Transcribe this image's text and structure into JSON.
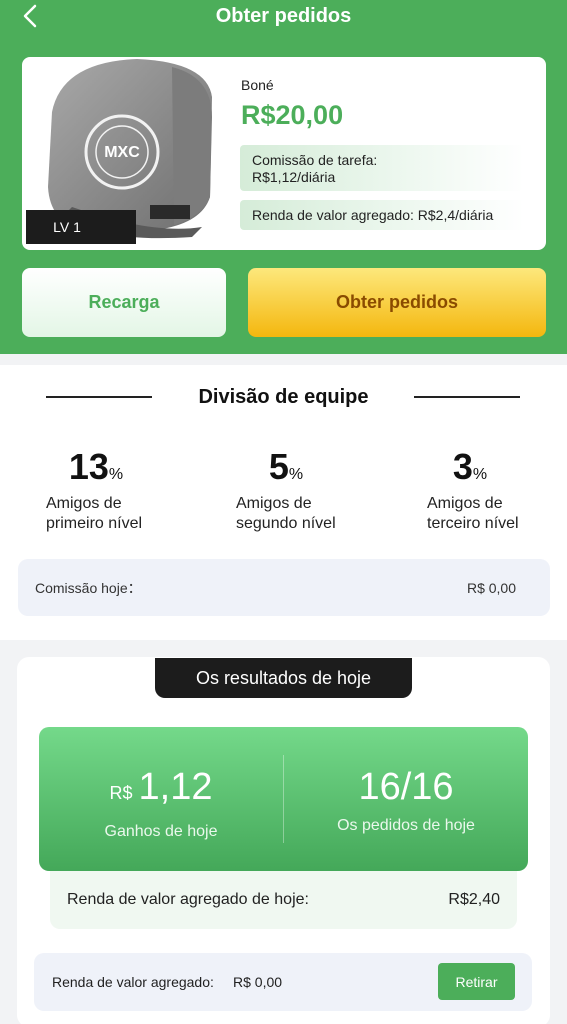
{
  "header": {
    "title": "Obter pedidos"
  },
  "product": {
    "name": "Boné",
    "price": "R$20,00",
    "commission_line1": "Comissão de tarefa:",
    "commission_line2": "R$1,12/diária",
    "value_income": "Renda de valor agregado: R$2,4/diária",
    "level": "LV 1",
    "image_icon": "cap-image"
  },
  "buttons": {
    "recharge": "Recarga",
    "get_orders": "Obter pedidos"
  },
  "team": {
    "title": "Divisão de equipe",
    "levels": [
      {
        "value": "13",
        "unit": "%",
        "label_line1": "Amigos de",
        "label_line2": "primeiro nível"
      },
      {
        "value": "5",
        "unit": "%",
        "label_line1": "Amigos de",
        "label_line2": "segundo nível"
      },
      {
        "value": "3",
        "unit": "%",
        "label_line1": "Amigos de",
        "label_line2": "terceiro nível"
      }
    ],
    "commission_label": "Comissão hoje：",
    "commission_value": "R$ 0,00"
  },
  "results": {
    "tab_title": "Os resultados de hoje",
    "earnings_currency": "R$",
    "earnings_value": "1,12",
    "earnings_label": "Ganhos de hoje",
    "orders_value": "16/16",
    "orders_label": "Os pedidos de hoje",
    "value_income_label": "Renda de valor agregado de hoje:",
    "value_income_value": "R$2,40",
    "added_value_label": "Renda de valor agregado:",
    "added_value_value": "R$ 0,00",
    "withdraw_label": "Retirar"
  },
  "colors": {
    "brand_green": "#4cae5a",
    "accent_yellow": "#f4b70e",
    "dark": "#1c1c1c"
  }
}
